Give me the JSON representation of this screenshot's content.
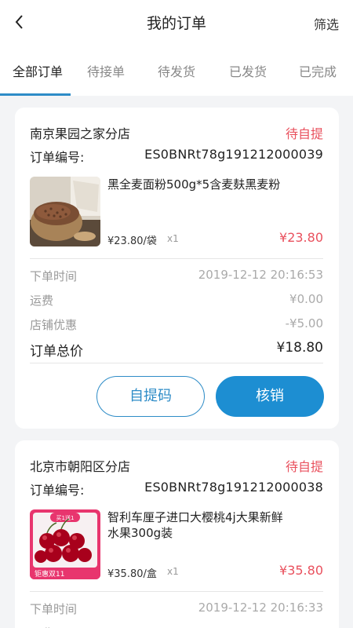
{
  "header": {
    "title": "我的订单",
    "filter_label": "筛选"
  },
  "tabs": [
    {
      "label": "全部订单",
      "active": true
    },
    {
      "label": "待接单"
    },
    {
      "label": "待发货"
    },
    {
      "label": "已发货"
    },
    {
      "label": "已完成"
    }
  ],
  "orders": [
    {
      "store": "南京果园之家分店",
      "status": "待自提",
      "order_no_label": "订单编号:",
      "order_no": "ES0BNRt78g191212000039",
      "product_name": "黑全麦面粉500g*5含麦麸黑麦粉",
      "unit_price": "¥23.80/袋",
      "quantity": "x1",
      "subtotal": "¥23.80",
      "order_time_label": "下单时间",
      "order_time": "2019-12-12 20:16:53",
      "shipping_label": "运费",
      "shipping": "¥0.00",
      "discount_label": "店铺优惠",
      "discount": "-¥5.00",
      "total_label": "订单总价",
      "total": "¥18.80",
      "pickup_code_label": "自提码",
      "verify_label": "核销"
    },
    {
      "store": "北京市朝阳区分店",
      "status": "待自提",
      "order_no_label": "订单编号:",
      "order_no": "ES0BNRt78g191212000038",
      "product_name": "智利车厘子进口大樱桃4j大果新鲜水果300g装",
      "image_badge_top": "买1送1",
      "image_badge_bottom": "钜惠双11",
      "unit_price": "¥35.80/盒",
      "quantity": "x1",
      "subtotal": "¥35.80",
      "order_time_label": "下单时间",
      "order_time": "2019-12-12 20:16:33",
      "shipping_label": "运费"
    }
  ],
  "colors": {
    "accent": "#1d8ed2",
    "status": "#e9515e"
  }
}
